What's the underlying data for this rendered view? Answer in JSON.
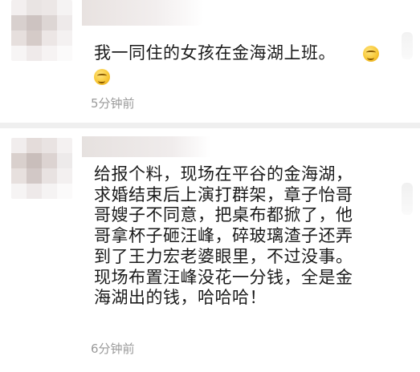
{
  "comments": [
    {
      "text": "我一同住的女孩在金海湖上班。",
      "time": "5分钟前",
      "emoji_icon": "grimacing-emoji-icon"
    },
    {
      "text": "给报个料，现场在平谷的金海湖，\n求婚结束后上演打群架，章子怡哥\n哥嫂子不同意，把桌布都掀了，他\n哥拿杯子砸汪峰，碎玻璃渣子还弄\n到了王力宏老婆眼里，不过没事。\n现场布置汪峰没花一分钱，全是金\n海湖出的钱，哈哈哈！",
      "time": "6分钟前"
    }
  ],
  "colors": {
    "background": "#ffffff",
    "separator": "#efefef",
    "text": "#1b1b1b",
    "timestamp": "#9a9a9a",
    "emoji": "#f7c531"
  }
}
